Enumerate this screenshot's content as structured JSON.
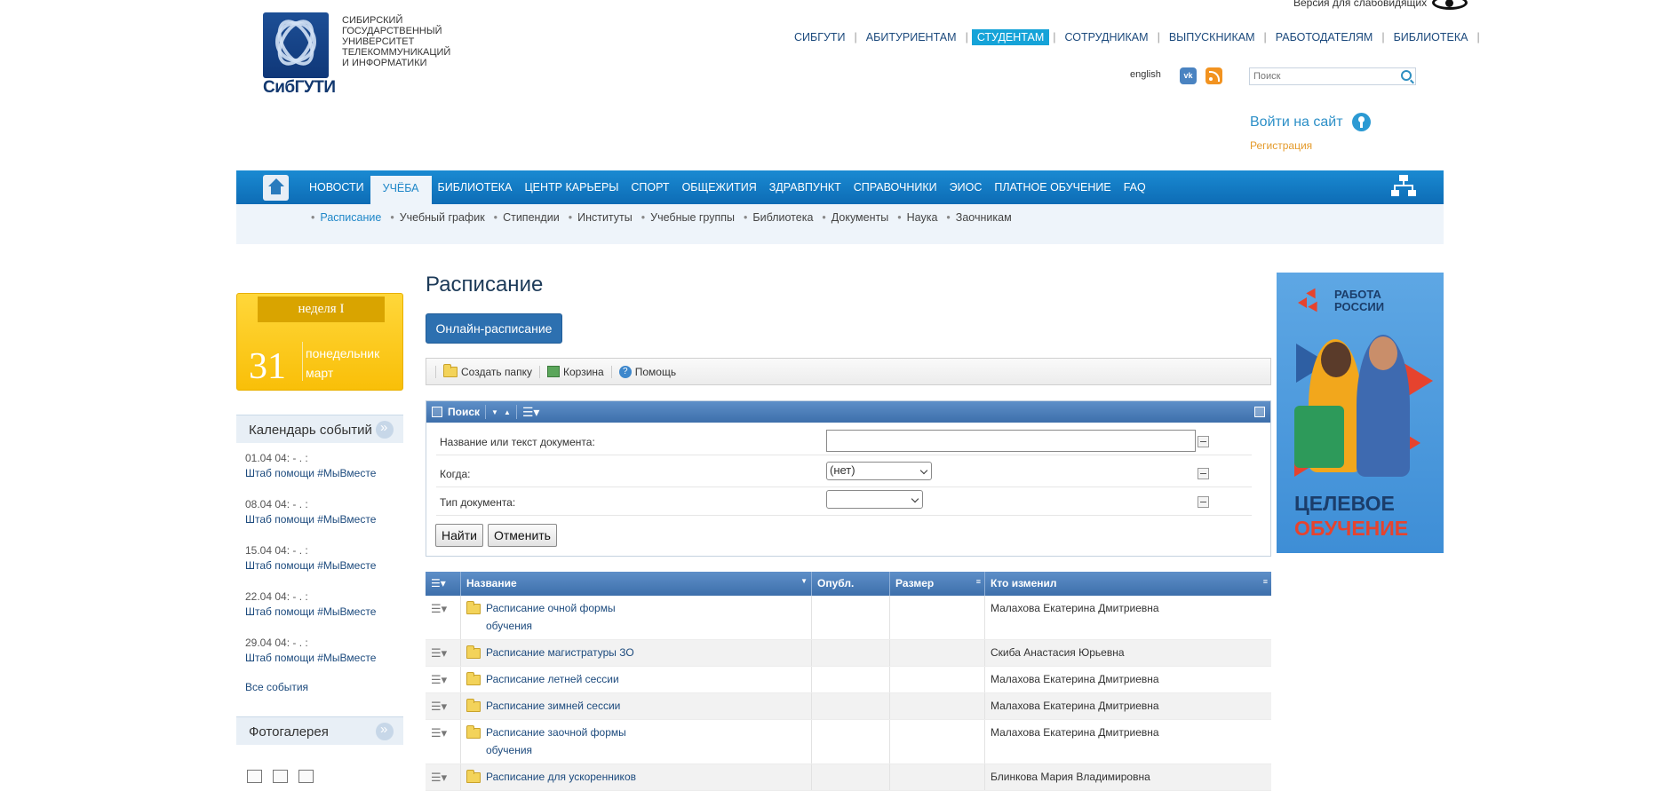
{
  "header": {
    "university_lines": [
      "СИБИРСКИЙ",
      "ГОСУДАРСТВЕННЫЙ",
      "УНИВЕРСИТЕТ",
      "ТЕЛЕКОММУНИКАЦИЙ",
      "И ИНФОРМАТИКИ"
    ],
    "logo_text": "СибГУТИ",
    "vision_label": "Версия для слабовидящих",
    "top_nav": [
      "СИБГУТИ",
      "АБИТУРИЕНТАМ",
      "СТУДЕНТАМ",
      "СОТРУДНИКАМ",
      "ВЫПУСКНИКАМ",
      "РАБОТОДАТЕЛЯМ",
      "БИБЛИОТЕКА"
    ],
    "top_nav_active": "СТУДЕНТАМ",
    "lang_label": "english",
    "vk_label": "vk",
    "search_placeholder": "Поиск",
    "login_label": "Войти на сайт",
    "register_label": "Регистрация"
  },
  "main_nav": {
    "items": [
      "НОВОСТИ",
      "УЧЁБА",
      "БИБЛИОТЕКА",
      "ЦЕНТР КАРЬЕРЫ",
      "СПОРТ",
      "ОБЩЕЖИТИЯ",
      "ЗДРАВПУНКТ",
      "СПРАВОЧНИКИ",
      "ЭИОС",
      "ПЛАТНОЕ ОБУЧЕНИЕ",
      "FAQ"
    ],
    "active": "УЧЁБА"
  },
  "sub_nav": {
    "items": [
      "Расписание",
      "Учебный график",
      "Стипендии",
      "Институты",
      "Учебные группы",
      "Библиотека",
      "Документы",
      "Наука",
      "Заочникам"
    ],
    "active": "Расписание"
  },
  "date_widget": {
    "week": "неделя I",
    "day": "31",
    "weekday": "понедельник",
    "month": "март"
  },
  "events": {
    "title": "Календарь событий",
    "items": [
      {
        "date": "01.04 04: - . :",
        "title": "Штаб помощи #МыВместе"
      },
      {
        "date": "08.04 04: - . :",
        "title": "Штаб помощи #МыВместе"
      },
      {
        "date": "15.04 04: - . :",
        "title": "Штаб помощи #МыВместе"
      },
      {
        "date": "22.04 04: - . :",
        "title": "Штаб помощи #МыВместе"
      },
      {
        "date": "29.04 04: - . :",
        "title": "Штаб помощи #МыВместе"
      }
    ],
    "all_label": "Все события"
  },
  "gallery": {
    "title": "Фотогалерея"
  },
  "page": {
    "title": "Расписание",
    "online_button": "Онлайн-расписание"
  },
  "toolbar": {
    "create_folder": "Создать папку",
    "trash": "Корзина",
    "help": "Помощь"
  },
  "search_form": {
    "title": "Поиск",
    "fields": [
      {
        "label": "Название или текст документа:",
        "value": ""
      },
      {
        "label": "Когда:",
        "value": "(нет)"
      },
      {
        "label": "Тип документа:",
        "value": ""
      }
    ],
    "find_button": "Найти",
    "cancel_button": "Отменить"
  },
  "table": {
    "columns": [
      "Название",
      "Опубл.",
      "Размер",
      "Кто изменил"
    ],
    "rows": [
      {
        "name": "Расписание очной формы обучения",
        "published": "",
        "size": "",
        "modified_by": "Малахова Екатерина Дмитриевна"
      },
      {
        "name": "Расписание магистратуры ЗО",
        "published": "",
        "size": "",
        "modified_by": "Скиба Анастасия Юрьевна"
      },
      {
        "name": "Расписание летней сессии",
        "published": "",
        "size": "",
        "modified_by": "Малахова Екатерина Дмитриевна"
      },
      {
        "name": "Расписание зимней сессии",
        "published": "",
        "size": "",
        "modified_by": "Малахова Екатерина Дмитриевна"
      },
      {
        "name": "Расписание заочной формы обучения",
        "published": "",
        "size": "",
        "modified_by": "Малахова Екатерина Дмитриевна"
      },
      {
        "name": "Расписание для ускоренников",
        "published": "",
        "size": "",
        "modified_by": "Блинкова Мария Владимировна"
      }
    ]
  },
  "banner": {
    "brand_line1": "РАБОТА",
    "brand_line2": "РОССИИ",
    "headline_line1": "ЦЕЛЕВОЕ",
    "headline_line2": "ОБУЧЕНИЕ"
  },
  "colors": {
    "nav_blue": "#0d6cb5",
    "accent": "#15a3d8",
    "date_yellow": "#f9bf08",
    "brand_red": "#e6432e"
  }
}
